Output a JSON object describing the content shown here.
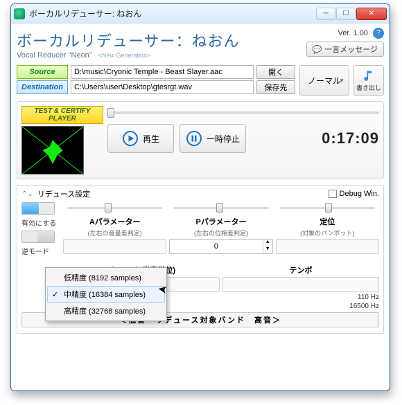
{
  "titlebar": {
    "title": "ボーカルリデューサー: ねおん"
  },
  "brand": {
    "jp": "ボーカルリデューサー：ねおん",
    "en": "Vocal Reducer \"Neon\"",
    "sub": "<New Generation>"
  },
  "version": {
    "label": "Ver. 1.00"
  },
  "msg_button": "一言メッセージ",
  "io": {
    "source_label": "Source",
    "dest_label": "Destination",
    "source_path": "D:\\music\\Cryonic Temple - Beast Slayer.aac",
    "dest_path": "C:\\Users\\user\\Desktop\\gtesrgt.wav",
    "open_btn": "開く",
    "dest_btn": "保存先",
    "mode": "ノーマル",
    "export": "書き出し"
  },
  "player": {
    "badge": "TEST & CERTIFY PLAYER",
    "play_label": "再生",
    "pause_label": "一時停止",
    "time": "0:17:09"
  },
  "reduce": {
    "title": "リデュース設定",
    "debug_label": "Debug Win.",
    "enable_label": "有効にする",
    "reverse_label": "逆モード",
    "cols": {
      "a_label": "Aパラメーター",
      "a_sub": "(左右の音量差判定)",
      "p_label": "Pパラメーター",
      "p_sub": "(左右の位相差判定)",
      "pan_label": "定位",
      "pan_sub": "(対象のパンポット)",
      "p_val": "0",
      "pitch_label": "チェンジ (半音単位)",
      "tempo_label": "テンポ"
    },
    "hz_low": "110 Hz",
    "hz_high": "16500 Hz",
    "band_text": "＜低音　リデュース対象バンド　高音＞"
  },
  "menu": {
    "items": [
      {
        "label": "低精度 (8192 samples)",
        "checked": false
      },
      {
        "label": "中精度 (16384 samples)",
        "checked": true
      },
      {
        "label": "高精度 (32768 samples)",
        "checked": false
      }
    ]
  }
}
